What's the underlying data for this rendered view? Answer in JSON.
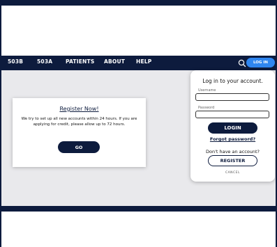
{
  "navbar": {
    "items": [
      "503B",
      "503A",
      "PATIENTS",
      "ABOUT",
      "HELP"
    ],
    "login_label": "LOG IN",
    "search_icon": "search-icon"
  },
  "register_card": {
    "title": "Register Now!",
    "message": "We try to set up all new accounts within 24 hours. If you are applying for credit, please allow up to 72 hours.",
    "go_label": "GO"
  },
  "login_panel": {
    "title": "Log in to your account.",
    "username_label": "Username",
    "username_value": "",
    "password_label": "Password",
    "password_value": "",
    "login_label": "LOGIN",
    "forgot_label": "Forgot password?",
    "no_account_label": "Don't have an account?",
    "register_label": "REGISTER",
    "cancel_label": "CANCEL"
  },
  "colors": {
    "navy": "#0d1b3d",
    "accent_blue": "#2f86f0",
    "content_bg": "#e9e9ec"
  }
}
